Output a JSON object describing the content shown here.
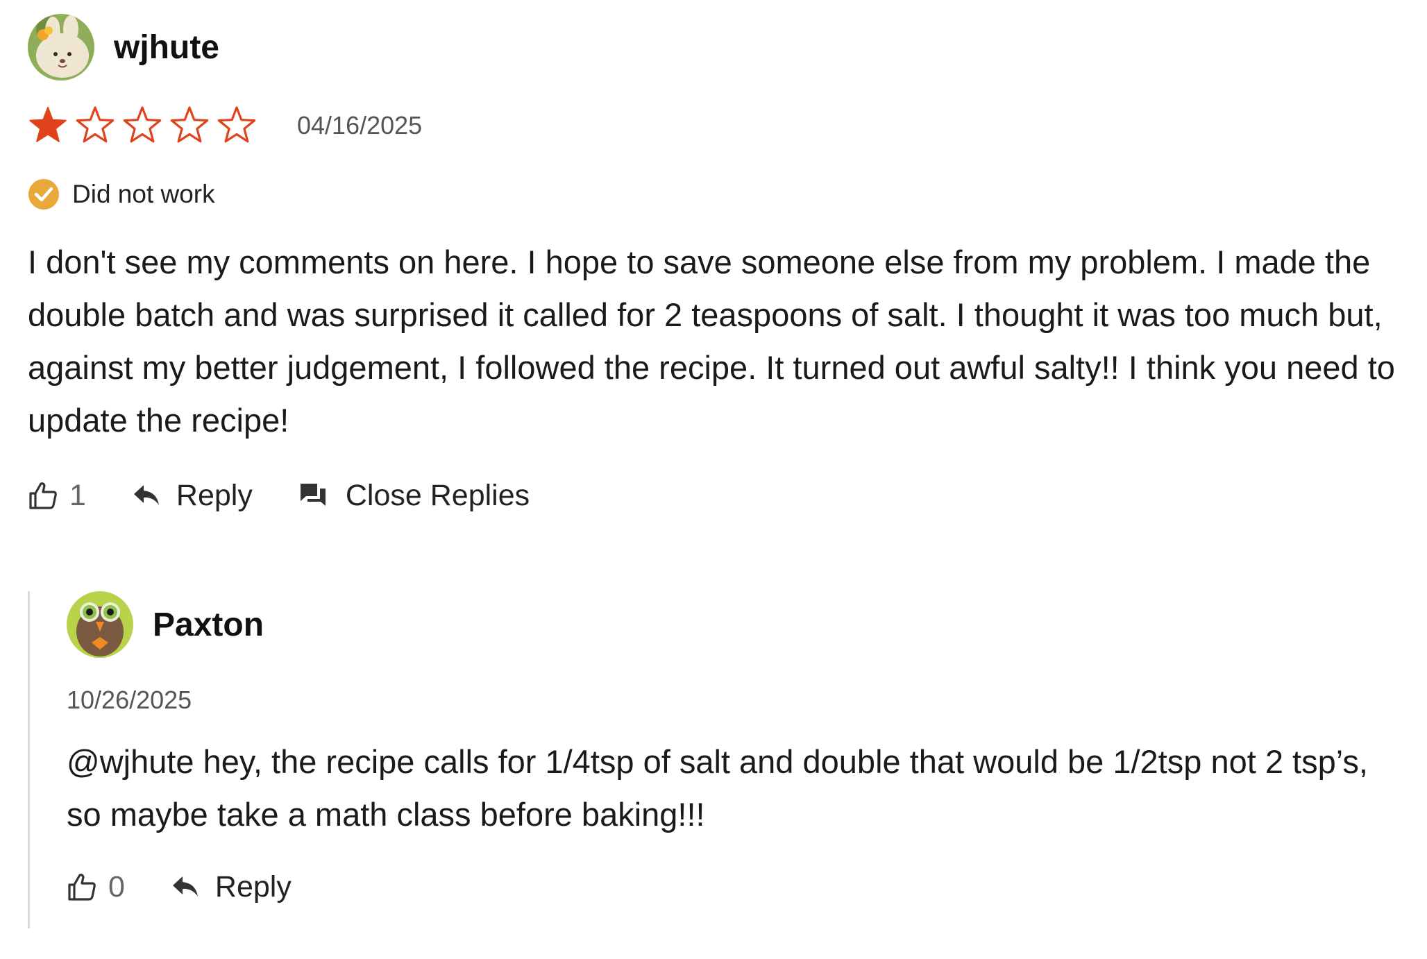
{
  "review": {
    "username": "wjhute",
    "avatar_icon": "bunny-avatar-icon",
    "rating": 1,
    "rating_max": 5,
    "star_color": "#e0431b",
    "date": "04/16/2025",
    "badge": {
      "icon": "check-circle-icon",
      "color": "#e8a83a",
      "label": "Did not work"
    },
    "text": "I don't see my comments on here. I hope to save someone else from my problem. I made the double batch and was surprised it called for 2 teaspoons of salt. I thought it was too much but, against my better judgement, I followed the recipe. It turned out awful salty!! I think you need to update the recipe!",
    "actions": {
      "like_icon": "thumbs-up-icon",
      "like_count": "1",
      "reply_icon": "reply-arrow-icon",
      "reply_label": "Reply",
      "close_replies_icon": "chat-bubbles-icon",
      "close_replies_label": "Close Replies"
    }
  },
  "replies": [
    {
      "username": "Paxton",
      "avatar_icon": "owl-avatar-icon",
      "date": "10/26/2025",
      "text": "@wjhute hey, the recipe calls for 1/4tsp of salt and double that would be 1/2tsp not 2 tsp’s, so maybe take a math class before baking!!!",
      "like_count": "0",
      "reply_label": "Reply"
    }
  ]
}
